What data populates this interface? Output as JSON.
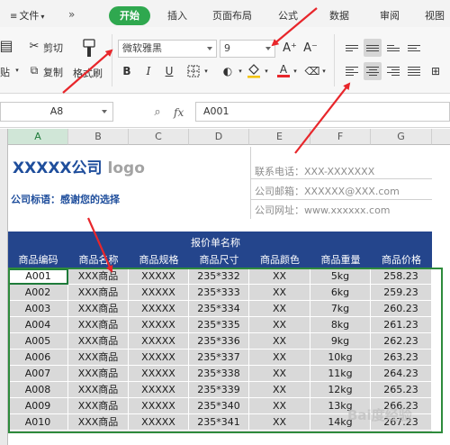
{
  "ribbon_tabs": {
    "file": "文件",
    "start": "开始",
    "insert": "插入",
    "layout": "页面布局",
    "formula": "公式",
    "data": "数据",
    "review": "审阅",
    "view": "视图"
  },
  "ribbon": {
    "cut": "剪切",
    "copy": "复制",
    "paste": "贴",
    "format_painter": "格式刷",
    "font_name": "微软雅黑",
    "font_size": "9",
    "font_grow": "A⁺",
    "font_shrink": "A⁻",
    "bold": "B",
    "italic": "I",
    "underline": "U",
    "font_color": "A",
    "icons": [
      "scissors-icon",
      "copy-icon",
      "format-painter-icon",
      "border-icon",
      "fill-color-icon",
      "font-color-icon",
      "eraser-icon",
      "align-top-icon",
      "align-middle-icon",
      "align-bottom-icon",
      "align-left-icon",
      "align-center-icon",
      "align-right-icon",
      "justify-icon"
    ]
  },
  "formula_bar": {
    "cell_ref": "A8",
    "fx": "fx",
    "value": "A001"
  },
  "columns": [
    "A",
    "B",
    "C",
    "D",
    "E",
    "F",
    "G"
  ],
  "sheet": {
    "logo_text": "XXXXX公司",
    "logo_suffix": "logo",
    "slogan": "公司标语：感谢您的选择",
    "contacts": [
      "联系电话：XXX-XXXXXXX",
      "公司邮箱：XXXXXX@XXX.com",
      "公司网址：www.xxxxxx.com"
    ],
    "table_title": "报价单名称",
    "headers": [
      "商品编码",
      "商品名称",
      "商品规格",
      "商品尺寸",
      "商品颜色",
      "商品重量",
      "商品价格"
    ],
    "rows": [
      [
        "A001",
        "XXX商品",
        "XXXXX",
        "235*332",
        "XX",
        "5kg",
        "258.23"
      ],
      [
        "A002",
        "XXX商品",
        "XXXXX",
        "235*333",
        "XX",
        "6kg",
        "259.23"
      ],
      [
        "A003",
        "XXX商品",
        "XXXXX",
        "235*334",
        "XX",
        "7kg",
        "260.23"
      ],
      [
        "A004",
        "XXX商品",
        "XXXXX",
        "235*335",
        "XX",
        "8kg",
        "261.23"
      ],
      [
        "A005",
        "XXX商品",
        "XXXXX",
        "235*336",
        "XX",
        "9kg",
        "262.23"
      ],
      [
        "A006",
        "XXX商品",
        "XXXXX",
        "235*337",
        "XX",
        "10kg",
        "263.23"
      ],
      [
        "A007",
        "XXX商品",
        "XXXXX",
        "235*338",
        "XX",
        "11kg",
        "264.23"
      ],
      [
        "A008",
        "XXX商品",
        "XXXXX",
        "235*339",
        "XX",
        "12kg",
        "265.23"
      ],
      [
        "A009",
        "XXX商品",
        "XXXXX",
        "235*340",
        "XX",
        "13kg",
        "266.23"
      ],
      [
        "A010",
        "XXX商品",
        "XXXXX",
        "235*341",
        "XX",
        "14kg",
        "267.23"
      ]
    ]
  },
  "watermark": "Bai度经验",
  "colors": {
    "accent_green": "#2fa84f",
    "header_band": "#24458c",
    "logo_blue": "#1f4e9c",
    "annotation_red": "#e8262b",
    "data_fill": "#d9d9d9"
  }
}
